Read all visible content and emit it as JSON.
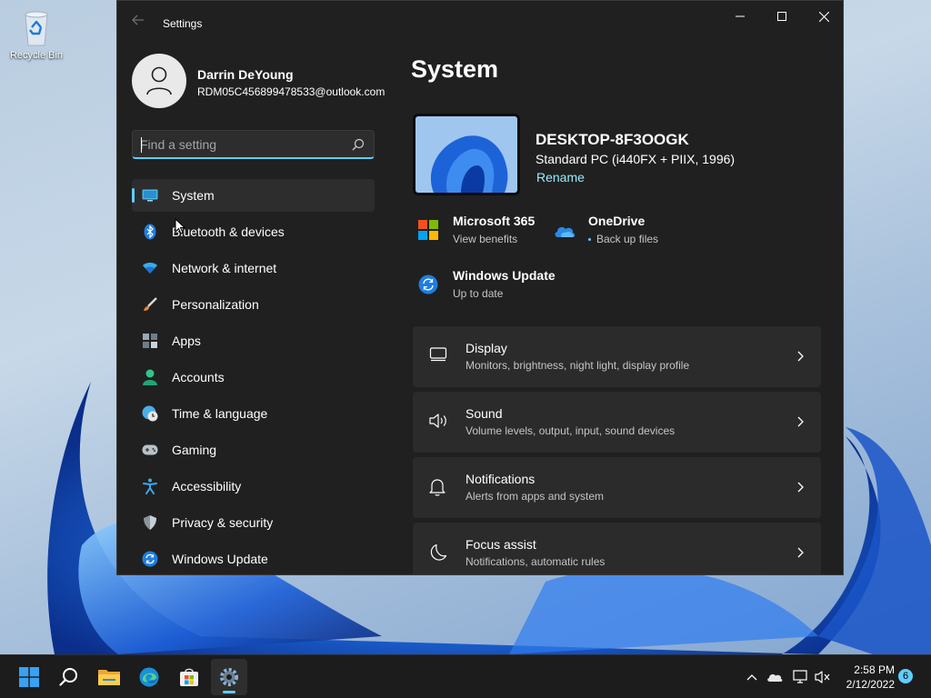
{
  "desktop": {
    "icons": [
      {
        "label": "Recycle Bin",
        "icon": "recycle-bin-icon"
      }
    ]
  },
  "window": {
    "app_title": "Settings",
    "controls": [
      "minimize",
      "maximize",
      "close"
    ]
  },
  "user": {
    "name": "Darrin DeYoung",
    "email": "RDM05C456899478533@outlook.com"
  },
  "search": {
    "placeholder": "Find a setting",
    "value": ""
  },
  "sidebar": {
    "items": [
      {
        "label": "System",
        "icon": "monitor-icon",
        "active": true
      },
      {
        "label": "Bluetooth & devices",
        "icon": "bluetooth-icon"
      },
      {
        "label": "Network & internet",
        "icon": "wifi-icon"
      },
      {
        "label": "Personalization",
        "icon": "paintbrush-icon"
      },
      {
        "label": "Apps",
        "icon": "apps-icon"
      },
      {
        "label": "Accounts",
        "icon": "person-icon"
      },
      {
        "label": "Time & language",
        "icon": "clock-globe-icon"
      },
      {
        "label": "Gaming",
        "icon": "gamepad-icon"
      },
      {
        "label": "Accessibility",
        "icon": "accessibility-icon"
      },
      {
        "label": "Privacy & security",
        "icon": "shield-icon"
      },
      {
        "label": "Windows Update",
        "icon": "update-icon"
      }
    ]
  },
  "main": {
    "title": "System",
    "device": {
      "name": "DESKTOP-8F3OOGK",
      "model": "Standard PC (i440FX + PIIX, 1996)",
      "rename_label": "Rename"
    },
    "quick_links": [
      {
        "title": "Microsoft 365",
        "subtitle": "View benefits",
        "icon": "microsoft-logo-icon"
      },
      {
        "title": "OneDrive",
        "subtitle": "Back up files",
        "icon": "onedrive-cloud-icon"
      },
      {
        "title": "Windows Update",
        "subtitle": "Up to date",
        "icon": "update-icon"
      }
    ],
    "cards": [
      {
        "title": "Display",
        "subtitle": "Monitors, brightness, night light, display profile",
        "icon": "display-icon"
      },
      {
        "title": "Sound",
        "subtitle": "Volume levels, output, input, sound devices",
        "icon": "speaker-icon"
      },
      {
        "title": "Notifications",
        "subtitle": "Alerts from apps and system",
        "icon": "bell-icon"
      },
      {
        "title": "Focus assist",
        "subtitle": "Notifications, automatic rules",
        "icon": "moon-icon"
      }
    ]
  },
  "taskbar": {
    "apps": [
      {
        "name": "Start",
        "icon": "windows-start-icon"
      },
      {
        "name": "Search",
        "icon": "search-icon"
      },
      {
        "name": "File Explorer",
        "icon": "folder-icon"
      },
      {
        "name": "Microsoft Edge",
        "icon": "edge-icon"
      },
      {
        "name": "Microsoft Store",
        "icon": "store-icon"
      },
      {
        "name": "Settings",
        "icon": "gear-icon",
        "active": true
      }
    ],
    "tray": [
      "chevron-up-icon",
      "onedrive-tray-icon",
      "network-icon",
      "volume-muted-icon"
    ],
    "time": "2:58 PM",
    "date": "2/12/2022",
    "notification_count": "6"
  },
  "colors": {
    "accent": "#60cdff",
    "window_bg": "#202020",
    "card_bg": "#2b2b2b",
    "link": "#99ebff"
  }
}
